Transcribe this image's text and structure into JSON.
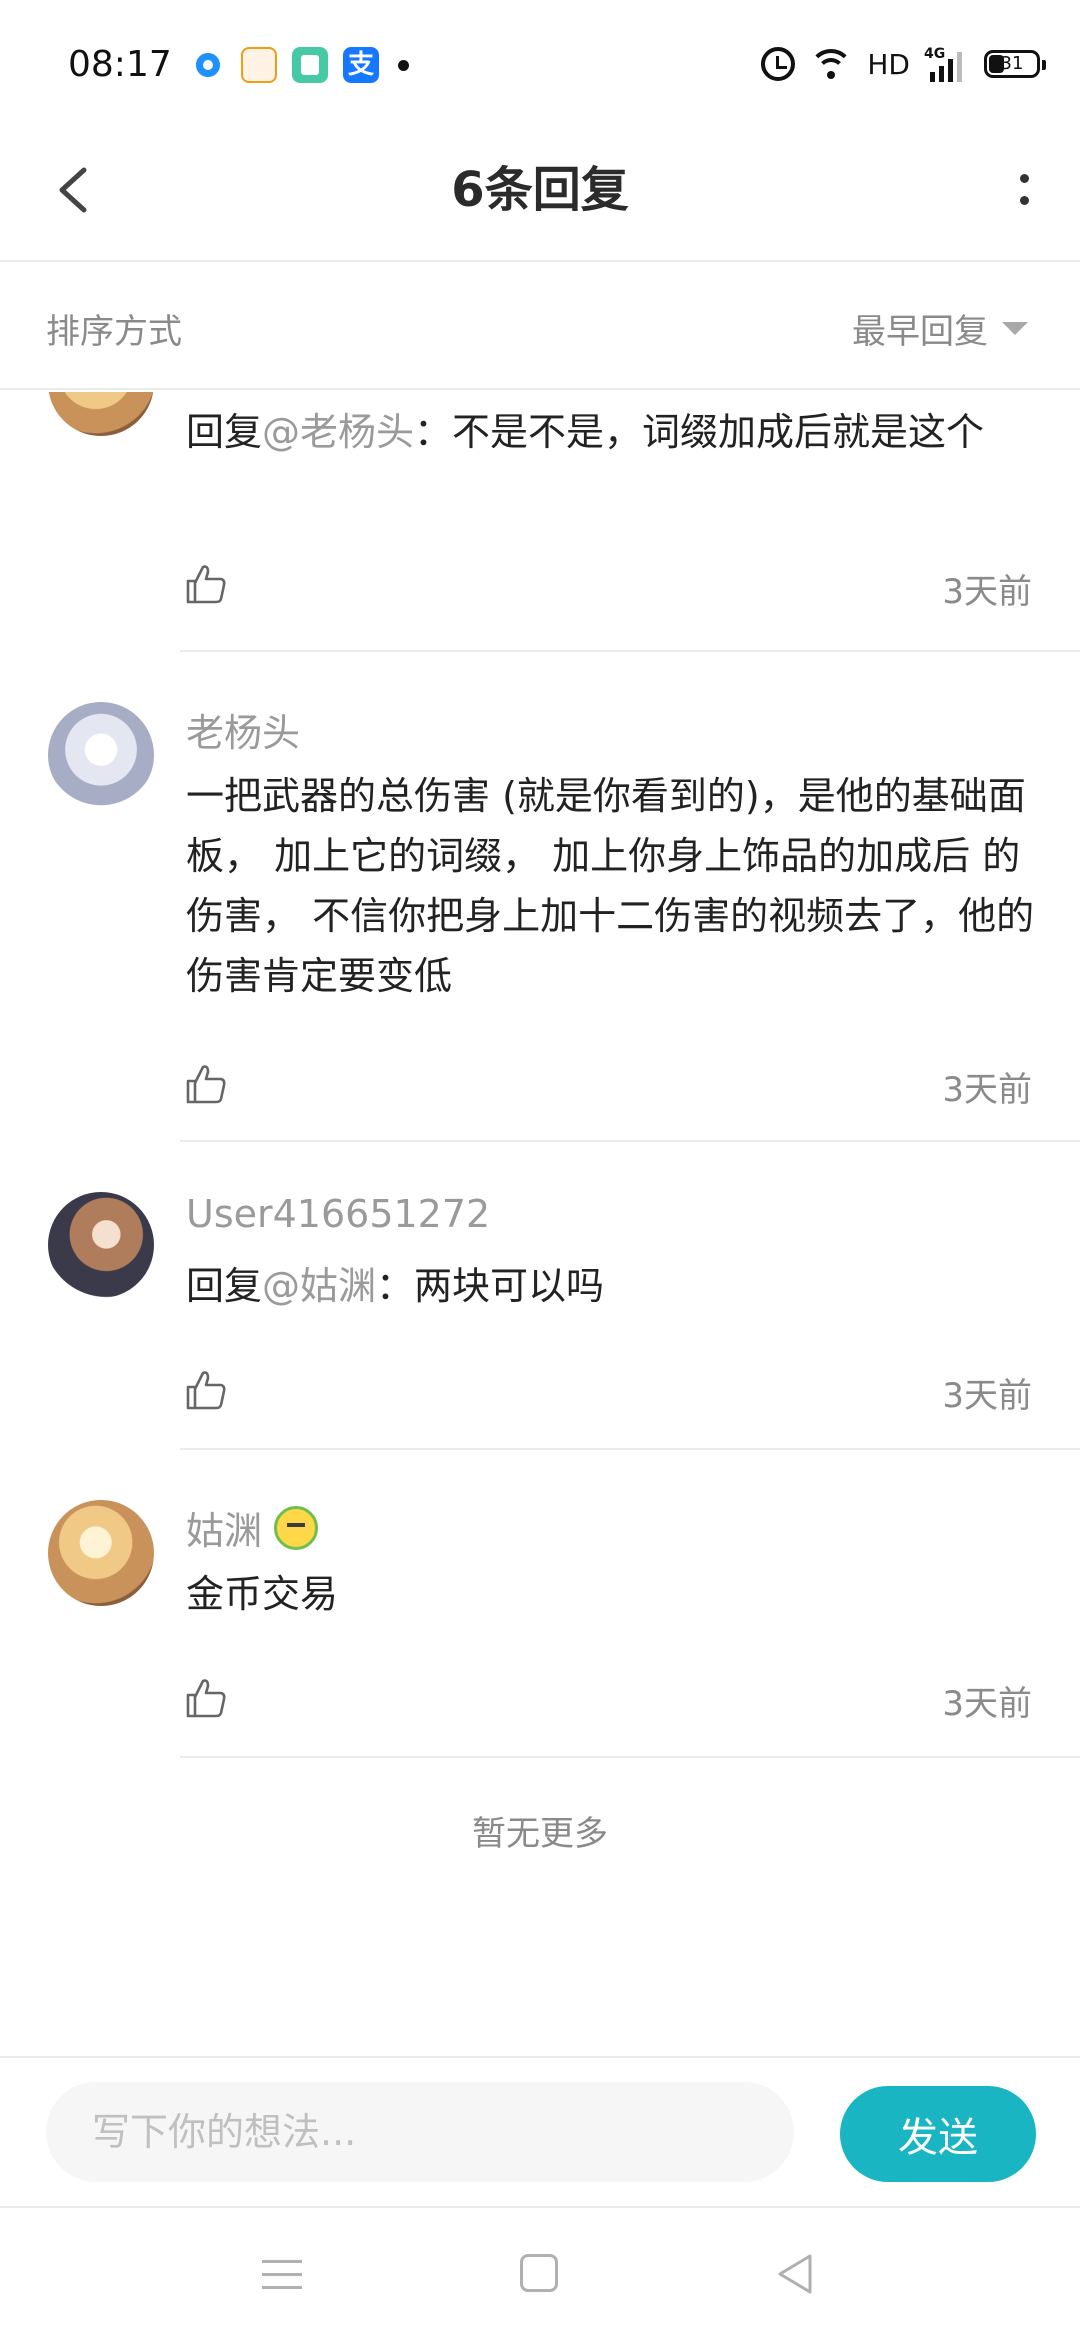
{
  "status_bar": {
    "time": "08:17",
    "network_label": "HD",
    "signal_label": "4G",
    "battery": "31"
  },
  "header": {
    "title": "6条回复"
  },
  "sort": {
    "label": "排序方式",
    "value": "最早回复"
  },
  "comments": [
    {
      "reply_prefix": "回复",
      "mention": "@老杨头",
      "text": "：不是不是，词缀加成后就是这个",
      "time": "3天前"
    },
    {
      "username": "老杨头",
      "text": "一把武器的总伤害 (就是你看到的)，是他的基础面板， 加上它的词缀， 加上你身上饰品的加成后 的伤害， 不信你把身上加十二伤害的视频去了，他的伤害肯定要变低",
      "time": "3天前"
    },
    {
      "username": "User416651272",
      "reply_prefix": "回复",
      "mention": "@姑渊",
      "text": "：两块可以吗",
      "time": "3天前"
    },
    {
      "username": "姑渊",
      "text": "金币交易",
      "time": "3天前"
    }
  ],
  "list_footer": "暂无更多",
  "composer": {
    "placeholder": "写下你的想法...",
    "send_label": "发送"
  },
  "colors": {
    "accent": "#19b5c2",
    "muted_text": "#8a8a8a",
    "divider": "#ececec"
  }
}
